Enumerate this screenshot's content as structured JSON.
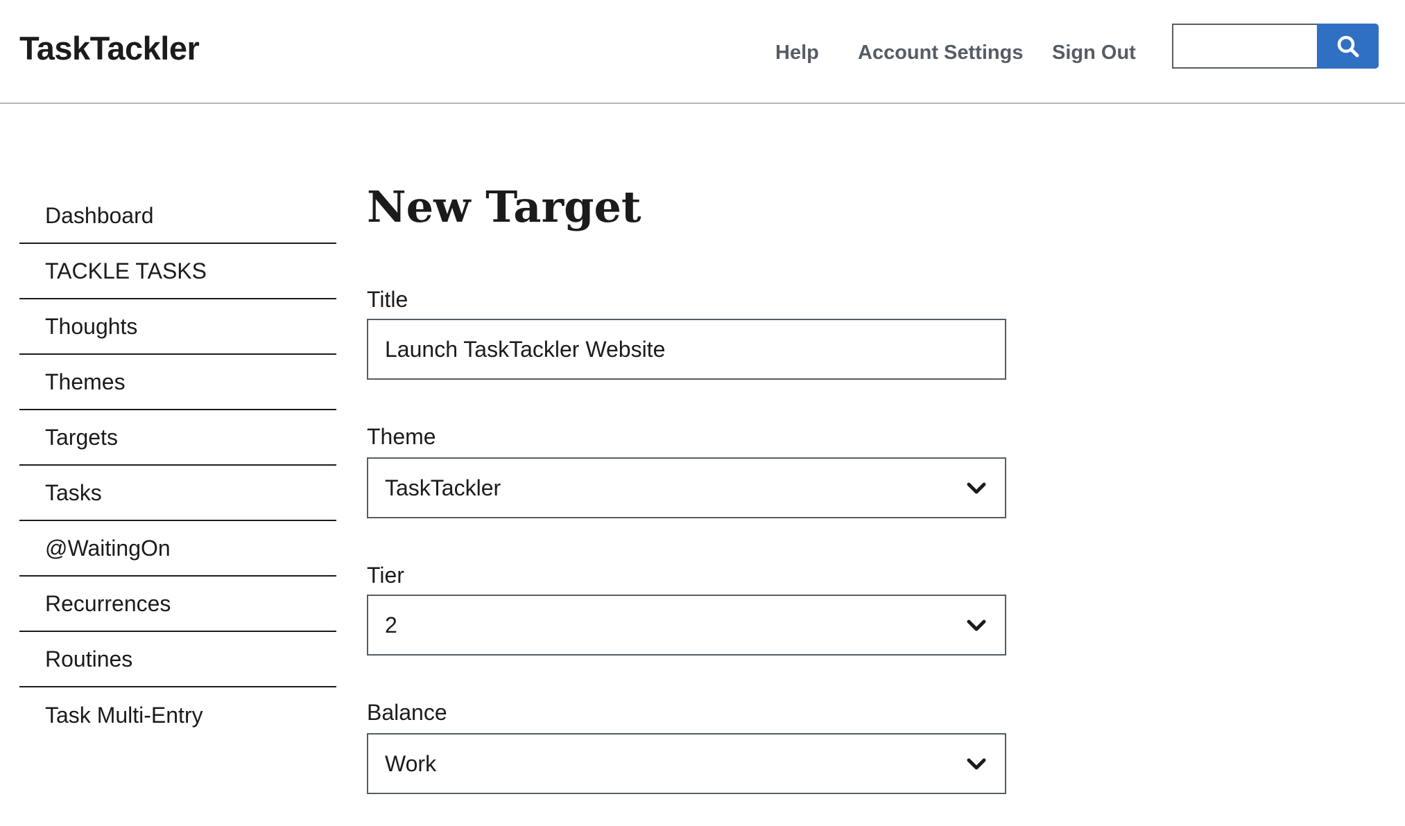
{
  "header": {
    "logo": "TaskTackler",
    "nav": {
      "help": "Help",
      "account_settings": "Account Settings",
      "sign_out": "Sign Out"
    },
    "search": {
      "value": "",
      "icon": "search-icon"
    }
  },
  "sidebar": {
    "items": [
      {
        "label": "Dashboard"
      },
      {
        "label": "TACKLE TASKS"
      },
      {
        "label": "Thoughts"
      },
      {
        "label": "Themes"
      },
      {
        "label": "Targets"
      },
      {
        "label": "Tasks"
      },
      {
        "label": "@WaitingOn"
      },
      {
        "label": "Recurrences"
      },
      {
        "label": "Routines"
      },
      {
        "label": "Task Multi-Entry"
      }
    ]
  },
  "main": {
    "title": "New Target",
    "fields": {
      "title": {
        "label": "Title",
        "value": "Launch TaskTackler Website"
      },
      "theme": {
        "label": "Theme",
        "value": "TaskTackler"
      },
      "tier": {
        "label": "Tier",
        "value": "2"
      },
      "balance": {
        "label": "Balance",
        "value": "Work"
      }
    }
  },
  "colors": {
    "accent": "#2f6fc4",
    "text": "#1b1b1b",
    "nav_text": "#565c65",
    "border": "#565c65"
  }
}
